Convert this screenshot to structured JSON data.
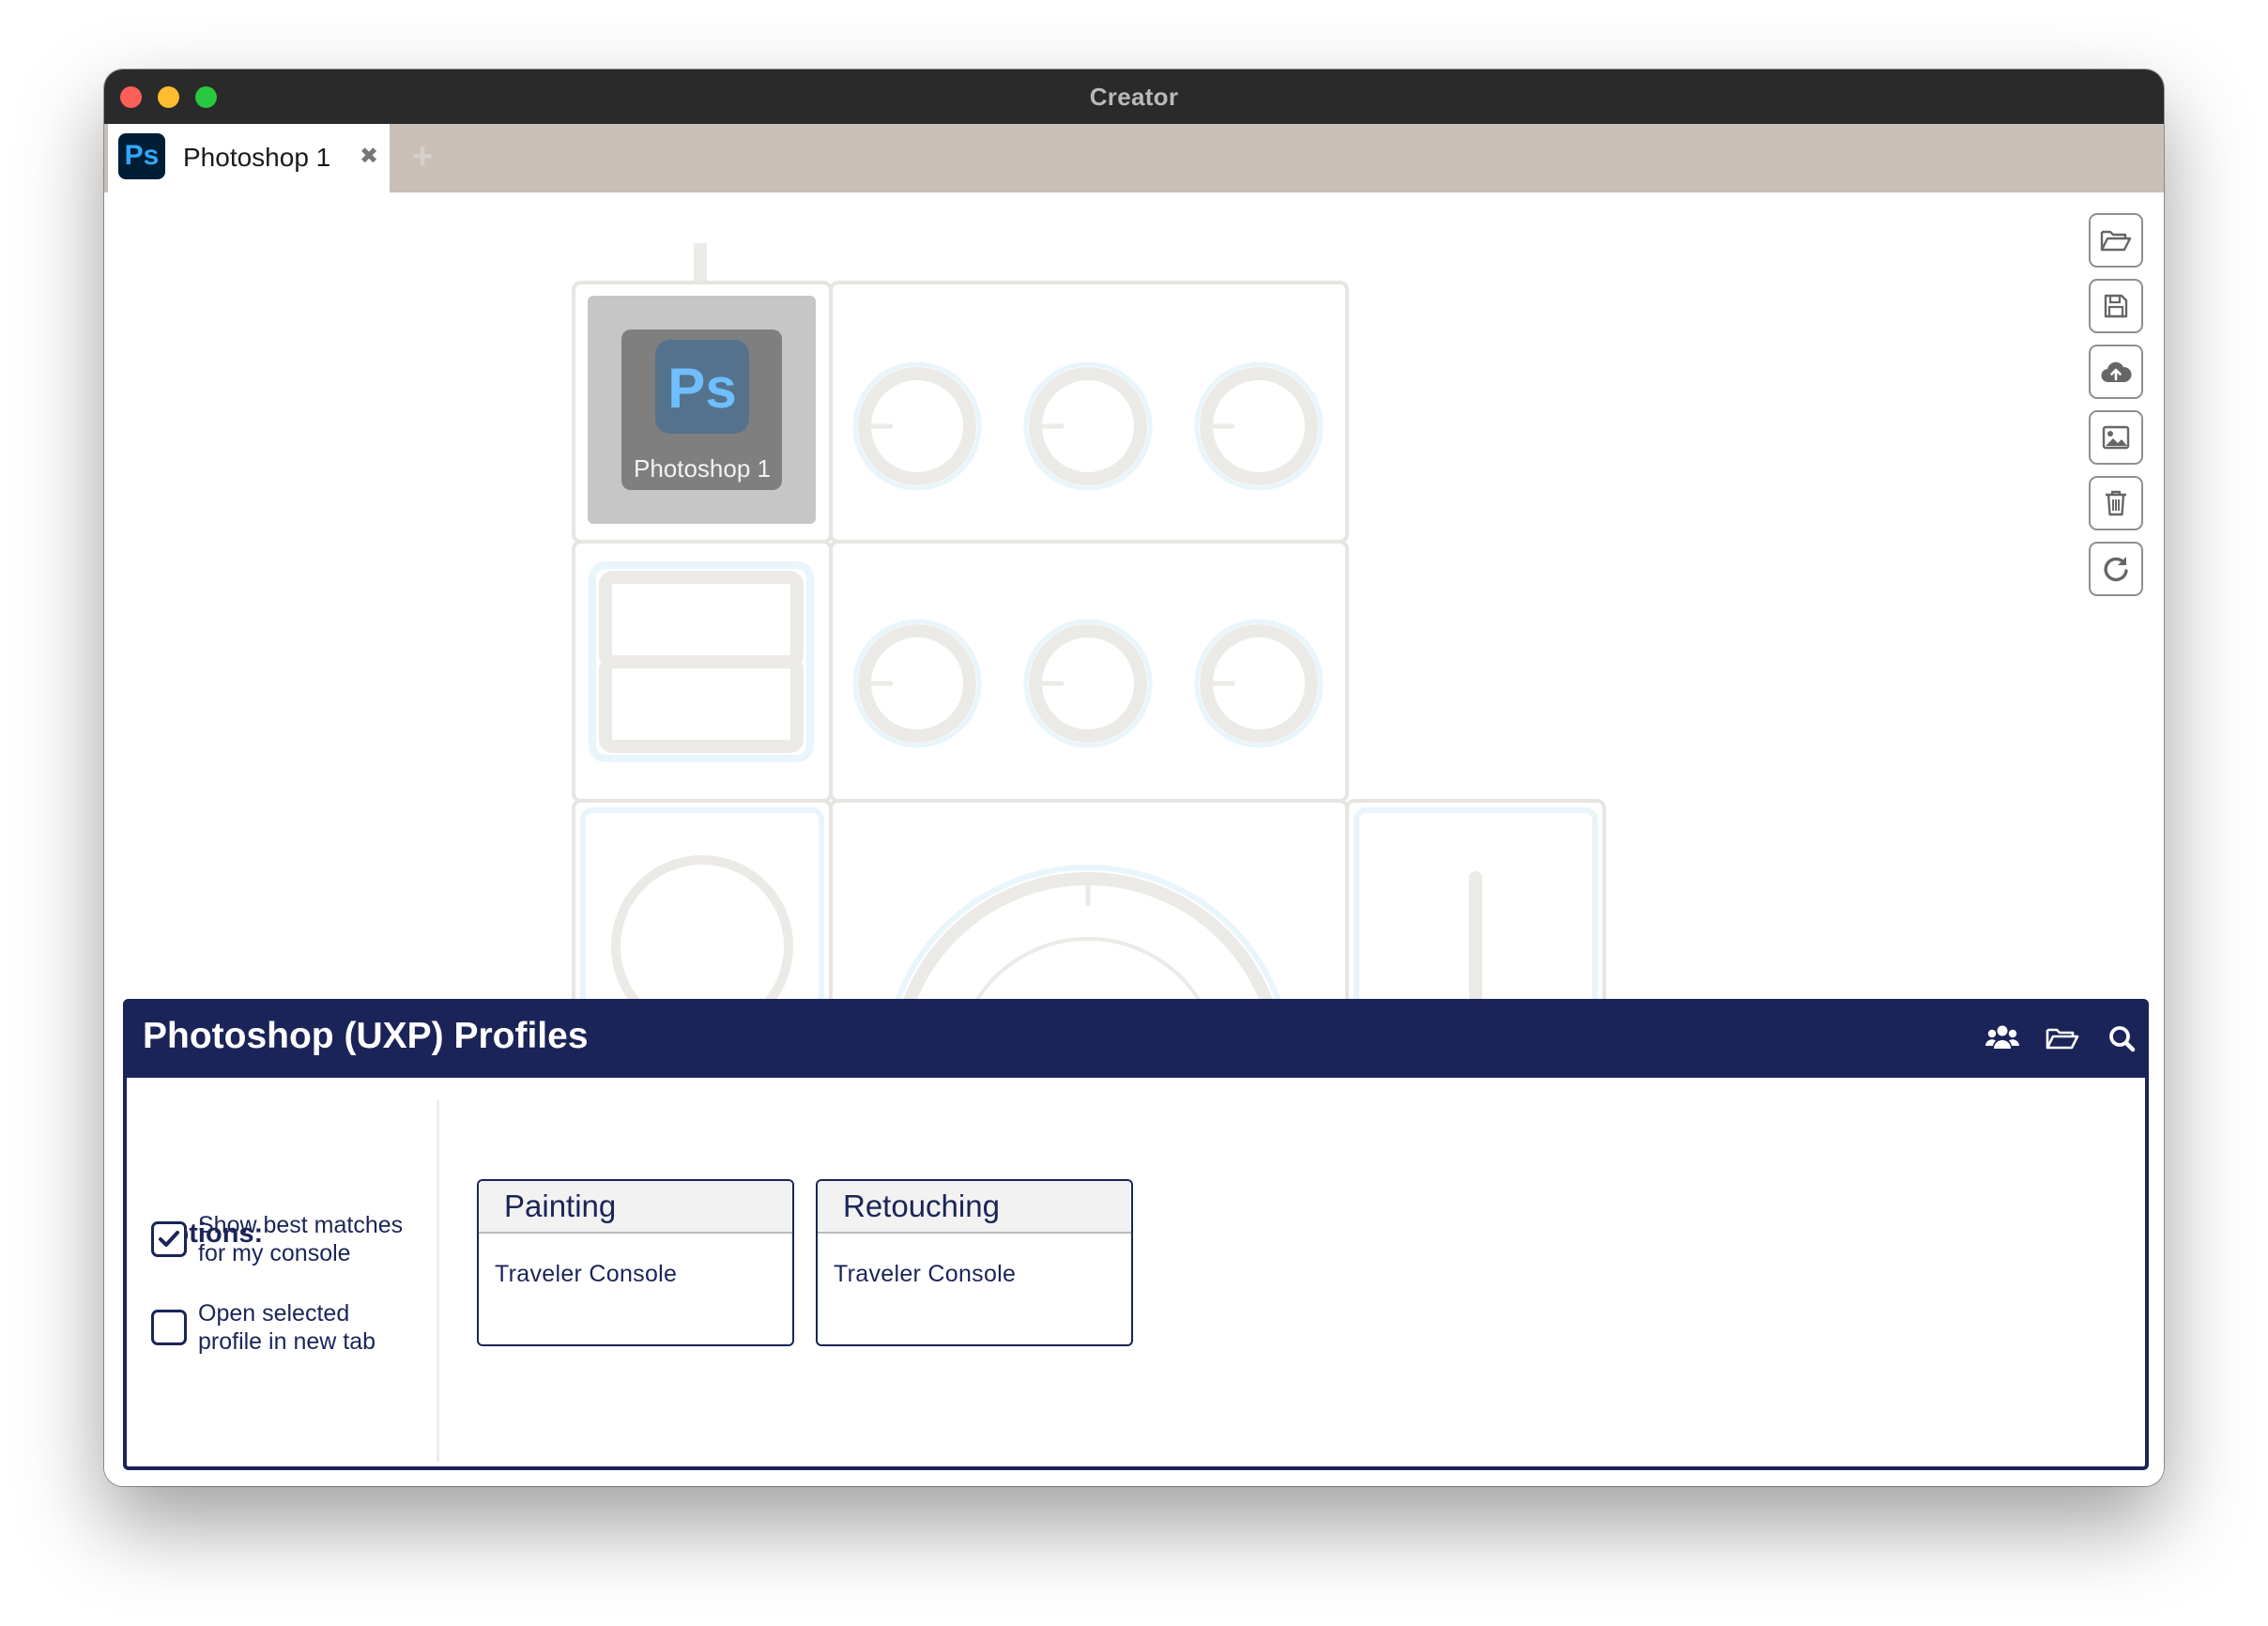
{
  "window": {
    "title": "Creator"
  },
  "tabs": [
    {
      "logo_text": "Ps",
      "label": "Photoshop 1",
      "close_glyph": "✖"
    }
  ],
  "tab_add_glyph": "+",
  "toolbar": {
    "buttons": [
      {
        "icon": "folder-open-icon"
      },
      {
        "icon": "save-icon"
      },
      {
        "icon": "cloud-upload-icon"
      },
      {
        "icon": "image-icon"
      },
      {
        "icon": "trash-icon"
      },
      {
        "icon": "refresh-icon"
      }
    ]
  },
  "console": {
    "tile_logo_text": "Ps",
    "tile_label": "Photoshop 1"
  },
  "panel": {
    "title": "Photoshop (UXP) Profiles",
    "header_icons": [
      "users-icon",
      "folder-open-icon",
      "search-icon"
    ],
    "options": {
      "heading": "Options:",
      "items": [
        {
          "label": "Show best matches for my console",
          "checked": true
        },
        {
          "label": "Open selected profile in new tab",
          "checked": false
        }
      ]
    },
    "profiles": [
      {
        "name": "Painting",
        "device": "Traveler Console"
      },
      {
        "name": "Retouching",
        "device": "Traveler Console"
      }
    ]
  },
  "colors": {
    "navy": "#1b2458",
    "photoshop_dark": "#001e36",
    "photoshop_blue": "#31a8ff",
    "tabbar": "#c7bfb8"
  }
}
